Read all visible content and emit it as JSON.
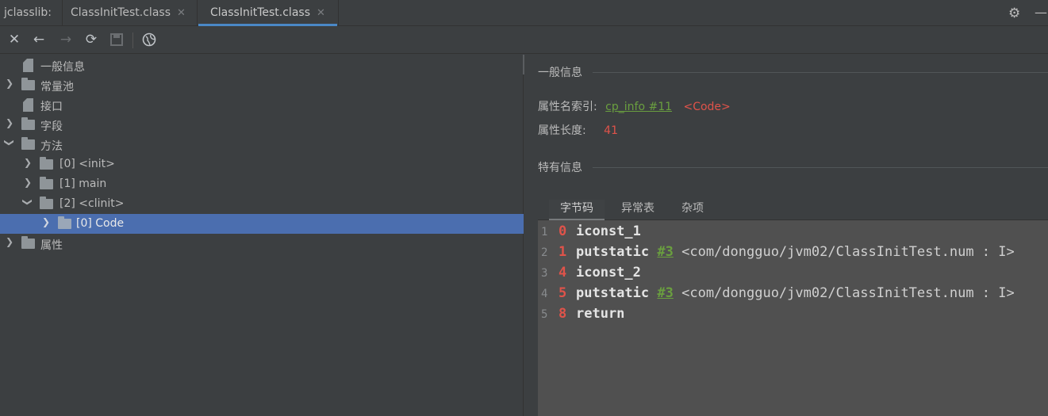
{
  "tabbar": {
    "lib_label": "jclasslib:",
    "tabs": [
      {
        "label": "ClassInitTest.class",
        "close": "✕"
      },
      {
        "label": "ClassInitTest.class",
        "close": "✕"
      }
    ],
    "active_tab": 1
  },
  "toolbar": {
    "icons": [
      "close-icon",
      "back-arrow-icon",
      "forward-arrow-icon",
      "refresh-icon",
      "save-icon",
      "browser-icon"
    ]
  },
  "tree": {
    "items": [
      {
        "label": "一般信息",
        "type": "file",
        "expandable": false
      },
      {
        "label": "常量池",
        "type": "folder",
        "expandable": true,
        "expanded": false
      },
      {
        "label": "接口",
        "type": "file",
        "expandable": false
      },
      {
        "label": "字段",
        "type": "folder",
        "expandable": true,
        "expanded": false
      },
      {
        "label": "方法",
        "type": "folder",
        "expandable": true,
        "expanded": true
      },
      {
        "label": "[0] <init>",
        "type": "folder",
        "expandable": true,
        "expanded": false
      },
      {
        "label": "[1] main",
        "type": "folder",
        "expandable": true,
        "expanded": false
      },
      {
        "label": "[2] <clinit>",
        "type": "folder",
        "expandable": true,
        "expanded": true
      },
      {
        "label": "[0] Code",
        "type": "folder",
        "expandable": true,
        "expanded": false,
        "selected": true
      },
      {
        "label": "属性",
        "type": "folder",
        "expandable": true,
        "expanded": false
      }
    ]
  },
  "general": {
    "title": "一般信息",
    "name_index_label": "属性名索引:",
    "name_index_link": "cp_info #11",
    "name_index_value": "<Code>",
    "length_label": "属性长度:",
    "length_value": "41"
  },
  "specific": {
    "title": "特有信息",
    "tabs": [
      "字节码",
      "异常表",
      "杂项"
    ],
    "active_tab": 0
  },
  "bytecode": {
    "lines": [
      {
        "line": "1",
        "offset": "0",
        "op": "iconst_1",
        "ref": "",
        "comment": ""
      },
      {
        "line": "2",
        "offset": "1",
        "op": "putstatic",
        "ref": "#3",
        "comment": "<com/dongguo/jvm02/ClassInitTest.num : I>"
      },
      {
        "line": "3",
        "offset": "4",
        "op": "iconst_2",
        "ref": "",
        "comment": ""
      },
      {
        "line": "4",
        "offset": "5",
        "op": "putstatic",
        "ref": "#3",
        "comment": "<com/dongguo/jvm02/ClassInitTest.num : I>"
      },
      {
        "line": "5",
        "offset": "8",
        "op": "return",
        "ref": "",
        "comment": ""
      }
    ]
  },
  "colors": {
    "background": "#3c3f41",
    "selection": "#4b6eaf",
    "offset": "#e0534a",
    "reference": "#6a9f3f",
    "code_background": "#505050"
  }
}
